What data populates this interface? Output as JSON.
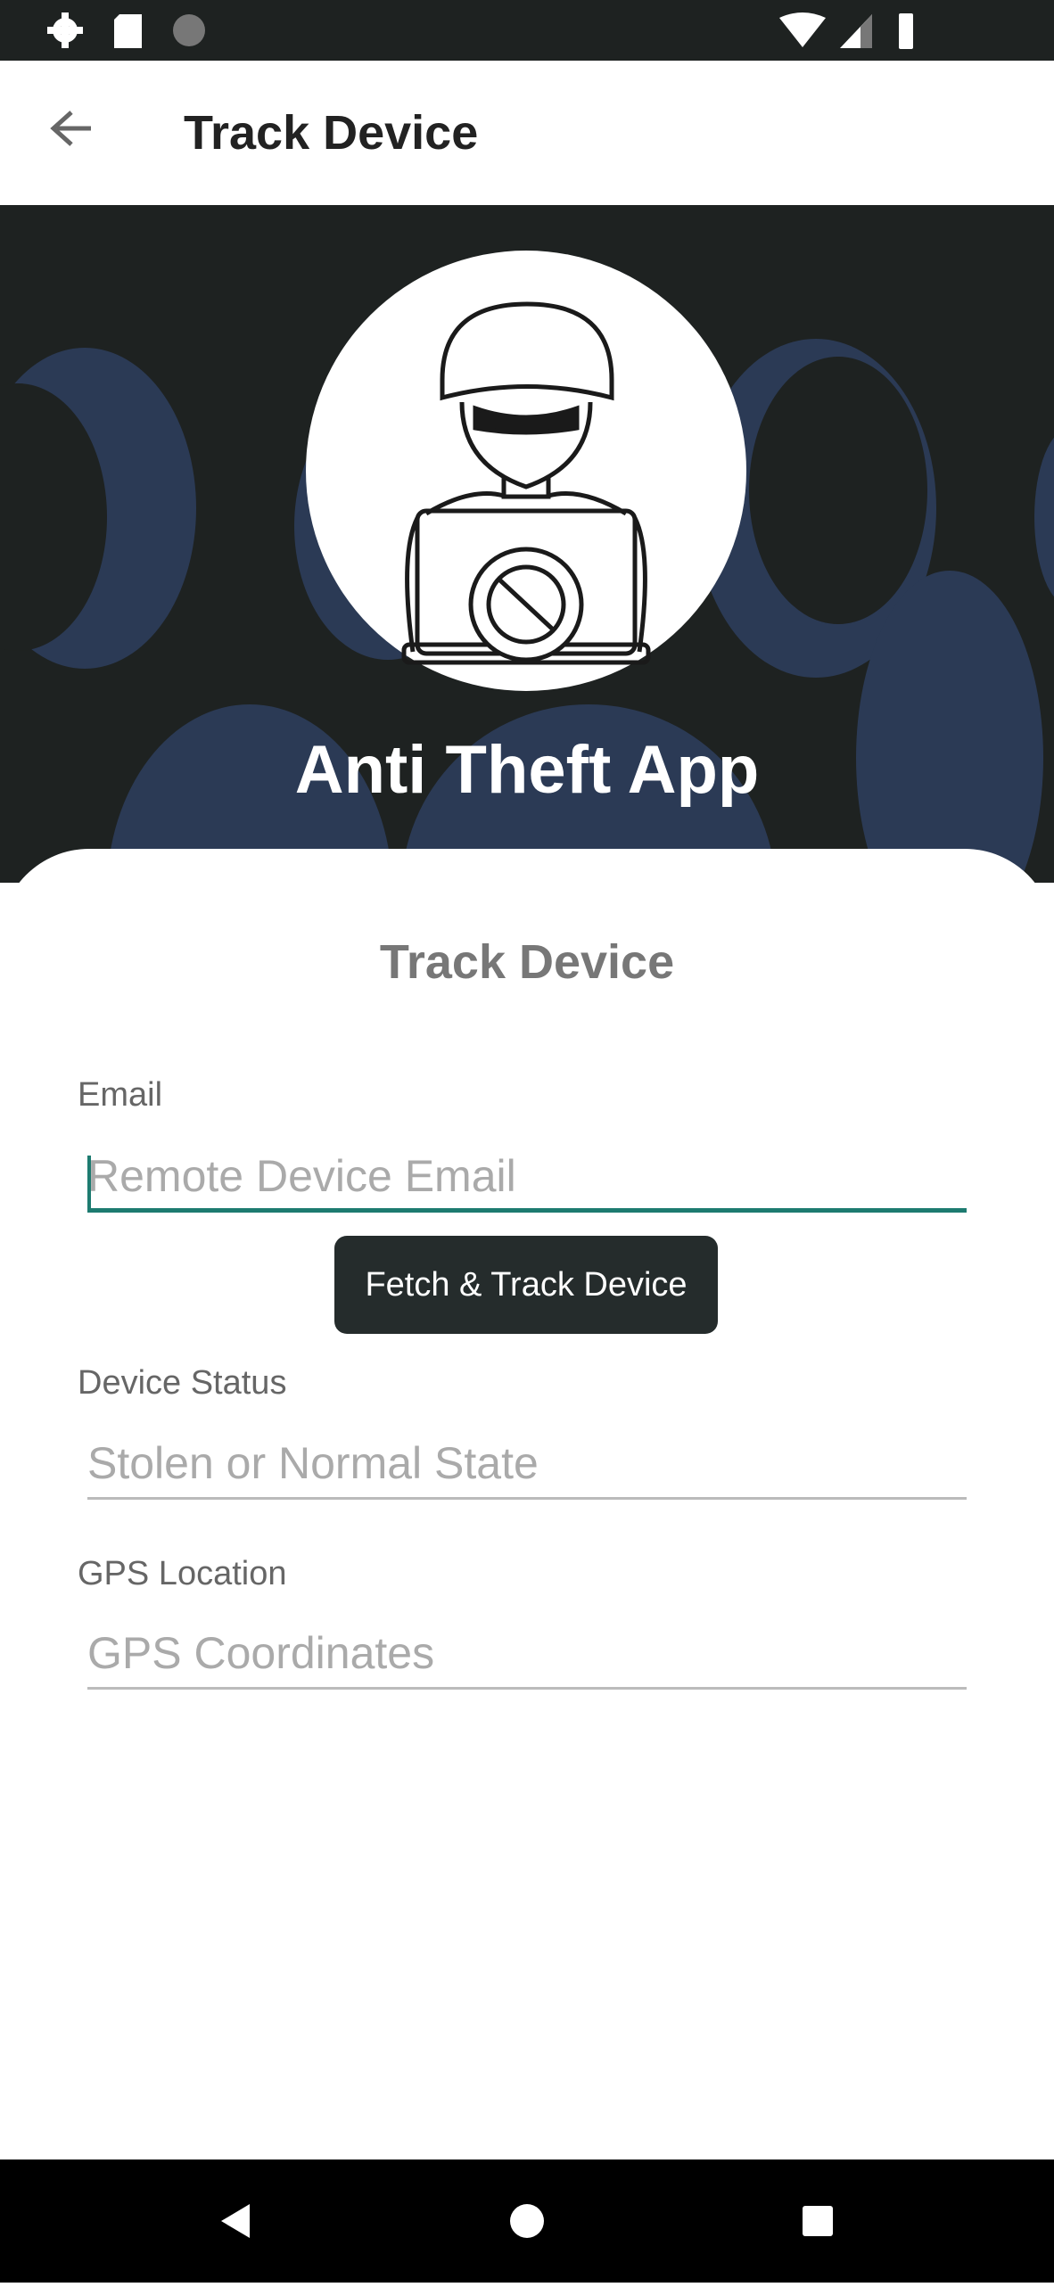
{
  "status_bar": {
    "icons": [
      "gear-icon",
      "sd-card-icon",
      "sync-icon",
      "wifi-icon",
      "signal-icon",
      "battery-icon"
    ]
  },
  "app_bar": {
    "title": "Track Device",
    "back_icon": "arrow-left-icon"
  },
  "hero": {
    "title": "Anti Theft App",
    "logo_icon": "hacker-laptop-icon"
  },
  "form": {
    "title": "Track Device",
    "email": {
      "label": "Email",
      "placeholder": "Remote Device Email",
      "value": ""
    },
    "fetch_button": "Fetch & Track Device",
    "status": {
      "label": "Device Status",
      "placeholder": "Stolen or Normal State"
    },
    "gps": {
      "label": "GPS Location",
      "placeholder": "GPS Coordinates"
    }
  },
  "colors": {
    "accent": "#1d7b70",
    "dark": "#1e2221",
    "pattern": "#2b3a55"
  }
}
